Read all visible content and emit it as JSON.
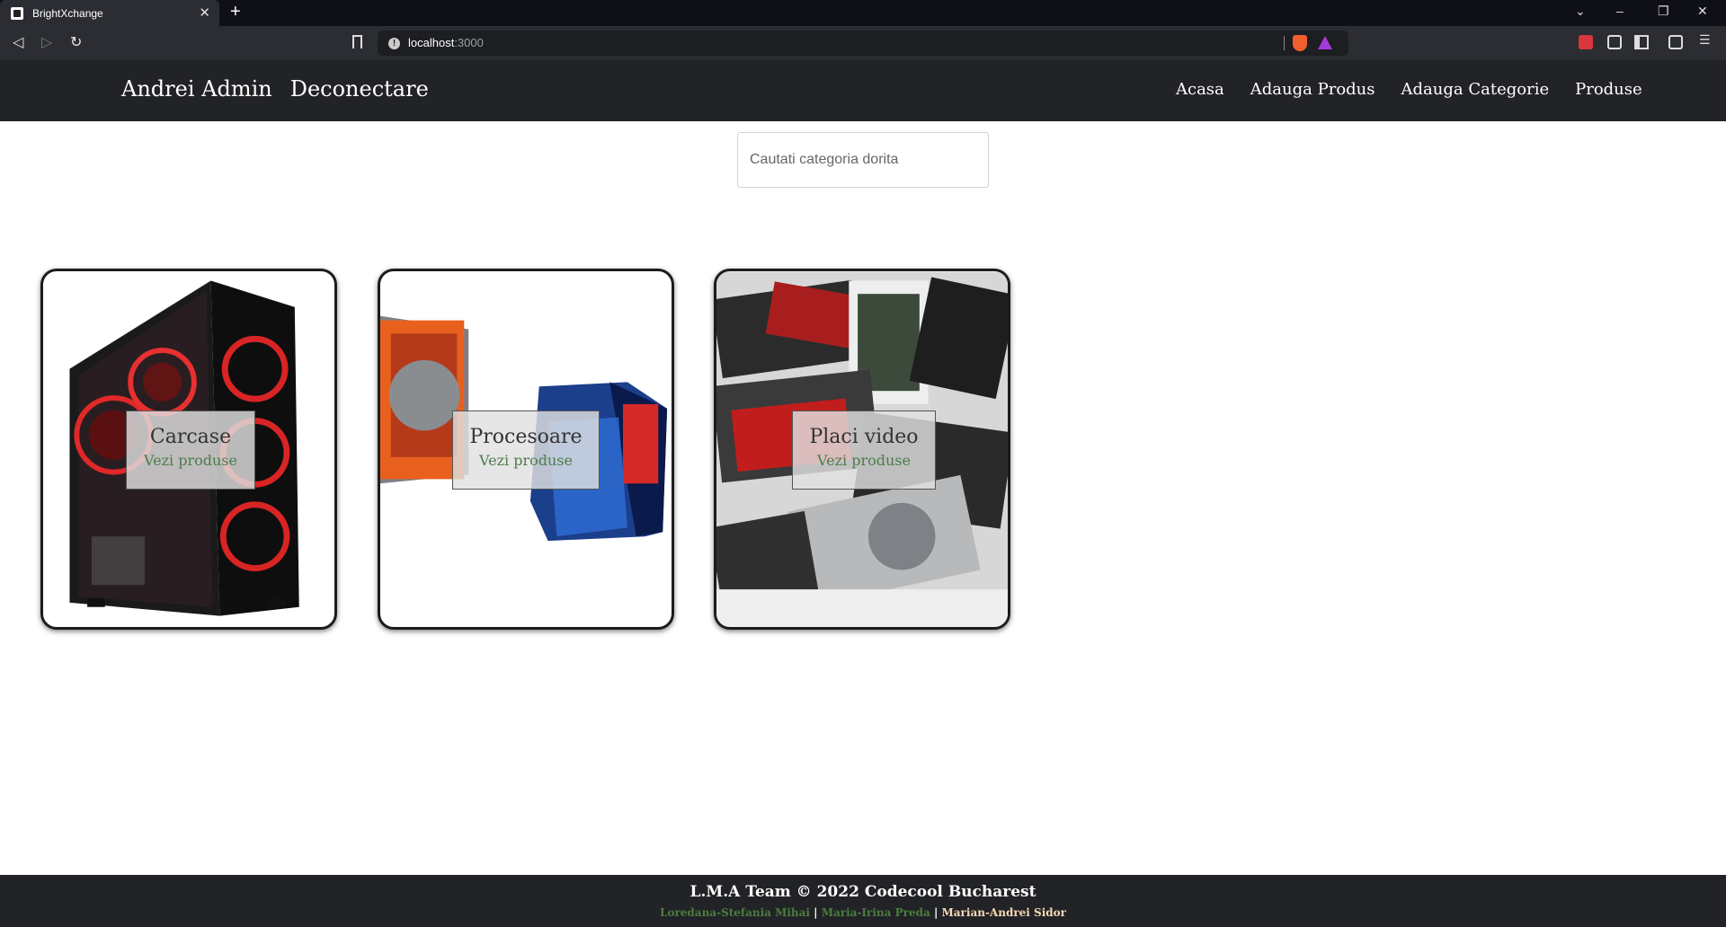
{
  "browser": {
    "tab_title": "BrightXchange",
    "url_host": "localhost",
    "url_port": ":3000"
  },
  "navbar": {
    "user_name": "Andrei Admin",
    "logout_label": "Deconectare",
    "links": [
      "Acasa",
      "Adauga Produs",
      "Adauga Categorie",
      "Produse"
    ]
  },
  "search": {
    "placeholder": "Cautati categoria dorita"
  },
  "categories": [
    {
      "title": "Carcase",
      "link": "Vezi produse"
    },
    {
      "title": "Procesoare",
      "link": "Vezi produse"
    },
    {
      "title": "Placi video",
      "link": "Vezi produse"
    }
  ],
  "footer": {
    "team": "L.M.A Team © 2022 Codecool Bucharest",
    "authors": [
      "Loredana-Stefania Mihai",
      "Maria-Irina Preda",
      "Marian-Andrei Sidor"
    ],
    "separator": "|"
  },
  "colors": {
    "navbar_bg": "#222326",
    "link_green": "#4b7d4b",
    "author_highlight": "#f3d9b4"
  }
}
